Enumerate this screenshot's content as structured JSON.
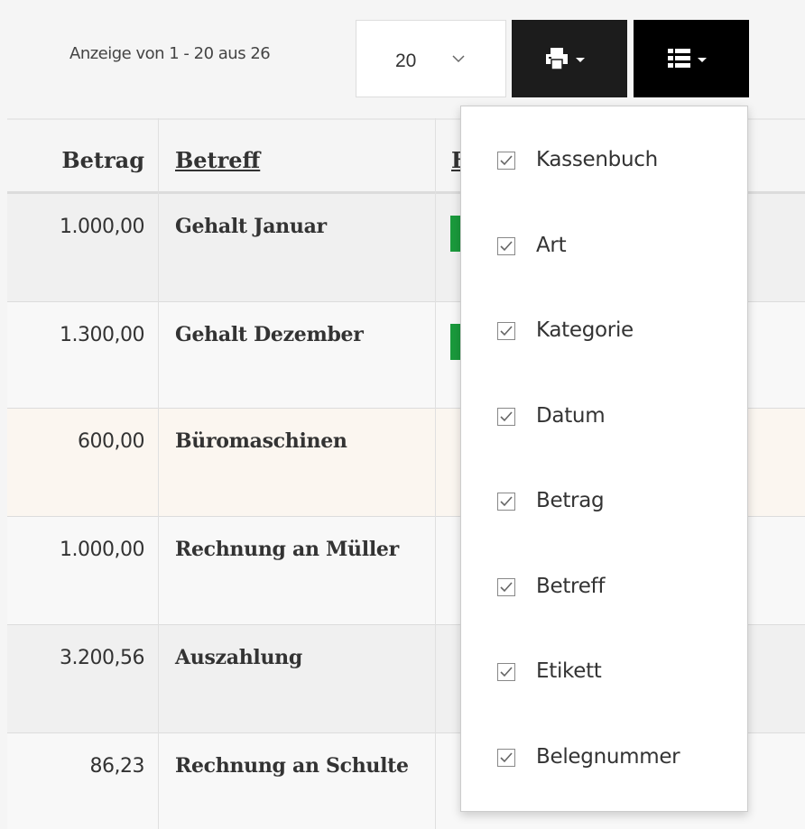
{
  "pagination": {
    "count_text": "Anzeige von 1 - 20 aus 26",
    "per_page": "20"
  },
  "toolbar": {
    "print_icon": "print-icon",
    "columns_icon": "list-icon"
  },
  "table": {
    "headers": {
      "amount": "Betrag",
      "subject": "Betreff",
      "tag": "E"
    },
    "rows": [
      {
        "amount": "1.000,00",
        "subject": "Gehalt Januar",
        "tag_color": "#1a9a3c",
        "bg": "#f0f0f0"
      },
      {
        "amount": "1.300,00",
        "subject": "Gehalt Dezember",
        "tag_color": "#1a9a3c",
        "bg": "#f8f8f8"
      },
      {
        "amount": "600,00",
        "subject": "Büromaschinen",
        "tag_color": "",
        "bg": "#fbf6f0"
      },
      {
        "amount": "1.000,00",
        "subject": "Rechnung an Müller",
        "tag_color": "",
        "bg": "#f8f8f8"
      },
      {
        "amount": "3.200,56",
        "subject": "Auszahlung",
        "tag_color": "",
        "bg": "#f0f0f0"
      },
      {
        "amount": "86,23",
        "subject": "Rechnung an Schulte",
        "tag_color": "",
        "bg": "#f8f8f8"
      }
    ]
  },
  "column_menu": {
    "items": [
      {
        "label": "Kassenbuch",
        "checked": true
      },
      {
        "label": "Art",
        "checked": true
      },
      {
        "label": "Kategorie",
        "checked": true
      },
      {
        "label": "Datum",
        "checked": true
      },
      {
        "label": "Betrag",
        "checked": true
      },
      {
        "label": "Betreff",
        "checked": true
      },
      {
        "label": "Etikett",
        "checked": true
      },
      {
        "label": "Belegnummer",
        "checked": true
      }
    ]
  }
}
